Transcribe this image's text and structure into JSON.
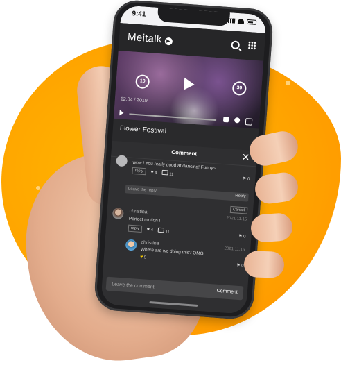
{
  "status": {
    "time": "9:41"
  },
  "app": {
    "brand": "Meitalk",
    "brand_badge": "▶"
  },
  "video": {
    "skip_back": "10",
    "skip_forward": "30",
    "date": "12.04 / 2019",
    "title": "Flower Festival"
  },
  "comments_sheet": {
    "title": "Comment",
    "close": "✕",
    "first": {
      "text": "wow ! You really good at dancing! Funny~",
      "reply_label": "reply",
      "likes": "4",
      "replies": "11",
      "flags": "0",
      "reply_placeholder": "Leave the reply",
      "reply_send": "Reply",
      "cancel": "Cancel"
    },
    "second": {
      "name": "christina",
      "date": "2021.11.15",
      "text": "Perfect motion !",
      "reply_label": "reply",
      "likes": "4",
      "replies": "11",
      "flags": "0"
    },
    "nested": {
      "name": "christina",
      "date": "2021.11.16",
      "text": "Where are we doing this? OMG",
      "likes": "5",
      "flags": "0"
    },
    "composer": {
      "placeholder": "Leave the comment",
      "send": "Comment"
    }
  },
  "colors": {
    "accent": "#ffa400",
    "screen": "#2a2a2c"
  }
}
